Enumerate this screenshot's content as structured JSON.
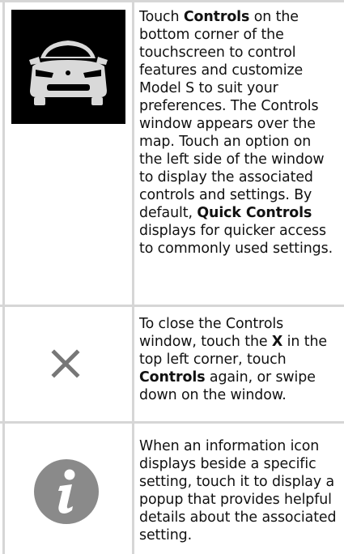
{
  "rows": [
    {
      "icon": "car-front-icon",
      "text": [
        {
          "t": "Touch ",
          "b": false
        },
        {
          "t": "Controls",
          "b": true
        },
        {
          "t": " on the bottom corner of the touchscreen to control features and customize Model S to suit your preferences. The Controls window appears over the map. Touch an option on the left side of the window to display the associated controls and settings. By default, ",
          "b": false
        },
        {
          "t": "Quick Controls",
          "b": true
        },
        {
          "t": " displays for quicker access to commonly used settings.",
          "b": false
        }
      ]
    },
    {
      "icon": "close-x-icon",
      "text": [
        {
          "t": "To close the Controls window, touch the ",
          "b": false
        },
        {
          "t": "X",
          "b": true
        },
        {
          "t": " in the top left corner, touch ",
          "b": false
        },
        {
          "t": "Controls",
          "b": true
        },
        {
          "t": " again, or swipe down on the window.",
          "b": false
        }
      ]
    },
    {
      "icon": "info-icon",
      "text": [
        {
          "t": "When an information icon displays beside a specific setting, touch it to display a popup that provides helpful details about the associated setting.",
          "b": false
        }
      ]
    }
  ],
  "colors": {
    "grid": "#d6d6d6",
    "text": "#111111",
    "icon_gray": "#777777",
    "info_circle": "#8a8a8a"
  }
}
